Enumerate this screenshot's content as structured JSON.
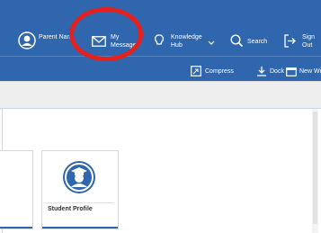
{
  "header": {
    "parent_name": "Parent Nam",
    "my_messages": [
      "My",
      "Messages"
    ],
    "knowledge_hub": [
      "Knowledge",
      "Hub"
    ],
    "search": "Search",
    "sign_out": [
      "Sign",
      "Out"
    ]
  },
  "toolbar": {
    "compress": "Compress",
    "dock": "Dock",
    "new_window": "New Window"
  },
  "tiles": [
    {
      "label": "Student Profile"
    }
  ],
  "colors": {
    "header_bg": "#2f66ad",
    "annotation": "#e3211f",
    "tile_accent": "#2f66ad"
  }
}
